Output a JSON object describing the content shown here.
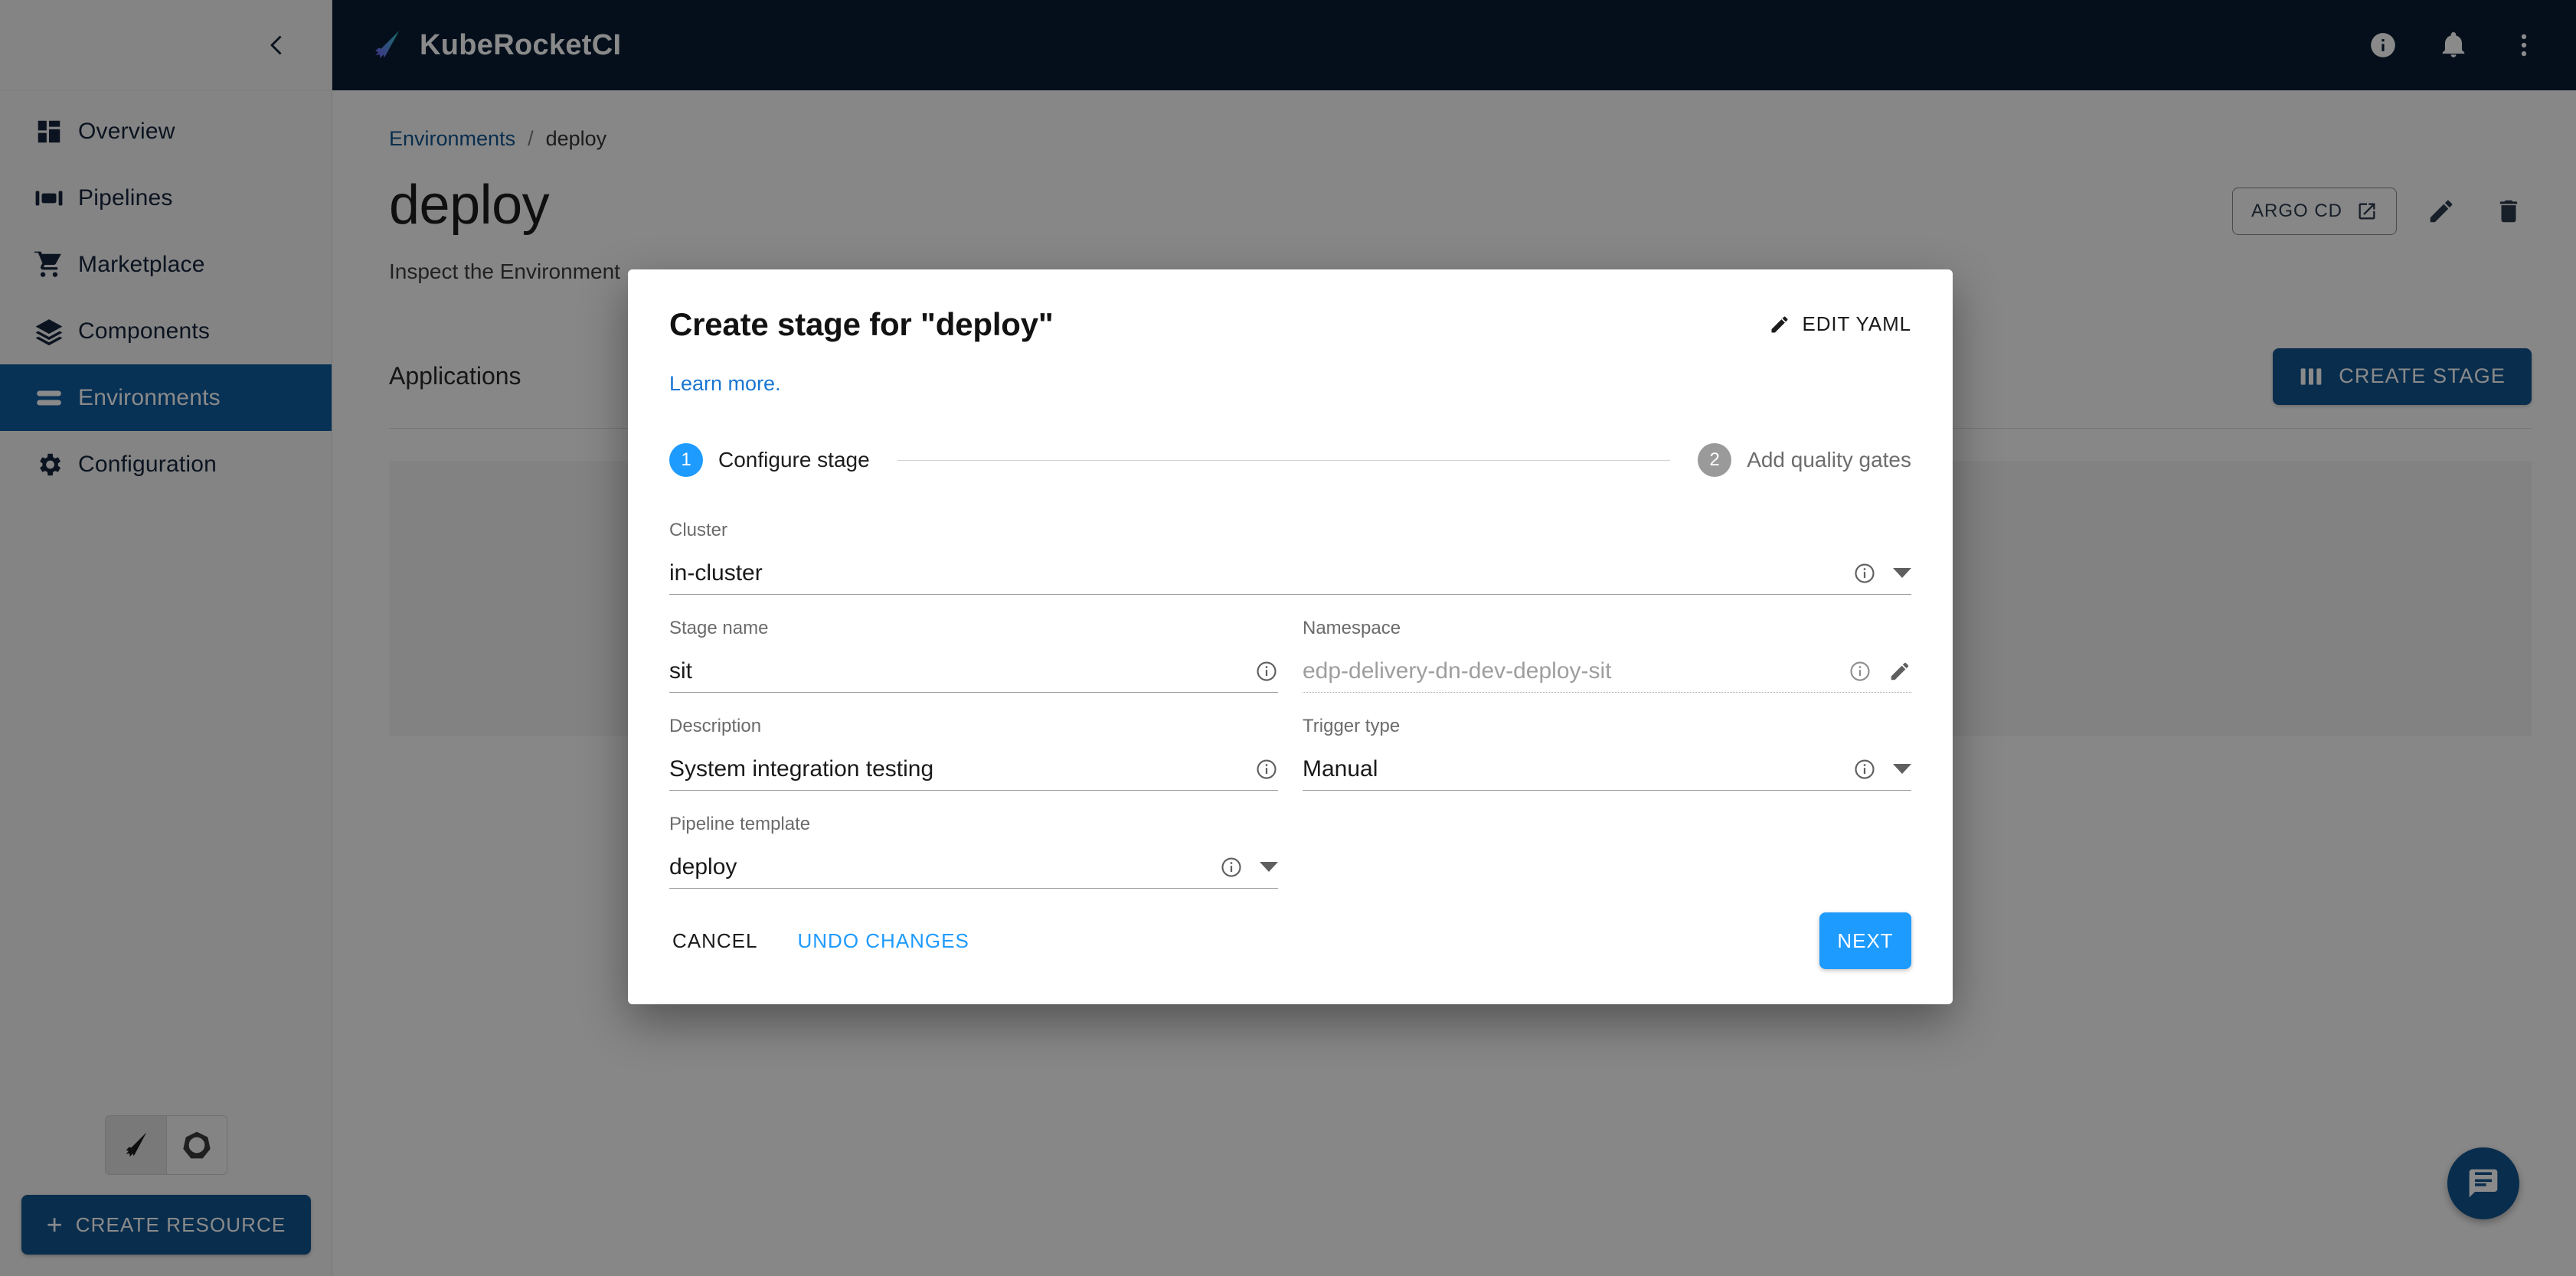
{
  "sidebar": {
    "collapse_icon": "chevron-left-icon",
    "items": [
      {
        "label": "Overview",
        "icon": "dashboard-icon",
        "active": false
      },
      {
        "label": "Pipelines",
        "icon": "pipelines-icon",
        "active": false
      },
      {
        "label": "Marketplace",
        "icon": "cart-icon",
        "active": false
      },
      {
        "label": "Components",
        "icon": "layers-icon",
        "active": false
      },
      {
        "label": "Environments",
        "icon": "environments-icon",
        "active": true
      },
      {
        "label": "Configuration",
        "icon": "gear-icon",
        "active": false
      }
    ],
    "cluster_toggle": [
      {
        "icon": "krci-feather-icon",
        "selected": true
      },
      {
        "icon": "kubernetes-icon",
        "selected": false
      }
    ],
    "create_resource_label": "CREATE RESOURCE",
    "create_resource_plus": "+"
  },
  "topbar": {
    "brand_name": "KubeRocketCI",
    "logo_icon": "krci-feather-icon",
    "actions": [
      {
        "icon": "info-circle-icon"
      },
      {
        "icon": "bell-icon"
      },
      {
        "icon": "more-vertical-icon"
      }
    ]
  },
  "main": {
    "breadcrumb": {
      "root_label": "Environments",
      "separator": "/",
      "current_label": "deploy"
    },
    "page_title": "deploy",
    "page_subtitle": "Inspect the Environment",
    "argo_cd_label": "ARGO CD",
    "argo_cd_icon": "external-link-icon",
    "edit_icon": "pencil-icon",
    "delete_icon": "trash-icon",
    "section_title": "Applications",
    "create_stage_label": "CREATE STAGE",
    "create_stage_icon": "columns-icon",
    "fab_icon": "chat-bubble-icon"
  },
  "dialog": {
    "title": "Create stage for \"deploy\"",
    "edit_yaml_label": "EDIT YAML",
    "edit_yaml_icon": "pencil-icon",
    "learn_more_label": "Learn more.",
    "steps": [
      {
        "number": "1",
        "label": "Configure stage",
        "state": "active"
      },
      {
        "number": "2",
        "label": "Add quality gates",
        "state": "inactive"
      }
    ],
    "fields": [
      {
        "name": "cluster",
        "label": "Cluster",
        "value": "in-cluster",
        "type": "select",
        "disabled": false,
        "adornments": [
          "info-circle-outline-icon",
          "chevron-down-icon"
        ]
      },
      {
        "name": "stage-name",
        "label": "Stage name",
        "value": "sit",
        "type": "text",
        "disabled": false,
        "adornments": [
          "info-circle-outline-icon"
        ]
      },
      {
        "name": "namespace",
        "label": "Namespace",
        "value": "edp-delivery-dn-dev-deploy-sit",
        "type": "text",
        "disabled": true,
        "adornments": [
          "info-circle-outline-icon",
          "pencil-icon"
        ]
      },
      {
        "name": "description",
        "label": "Description",
        "value": "System integration testing",
        "type": "text",
        "disabled": false,
        "adornments": [
          "info-circle-outline-icon"
        ]
      },
      {
        "name": "trigger-type",
        "label": "Trigger type",
        "value": "Manual",
        "type": "select",
        "disabled": false,
        "adornments": [
          "info-circle-outline-icon",
          "chevron-down-icon"
        ]
      },
      {
        "name": "pipeline-template",
        "label": "Pipeline template",
        "value": "deploy",
        "type": "select",
        "disabled": false,
        "adornments": [
          "info-circle-outline-icon",
          "chevron-down-icon"
        ]
      }
    ],
    "cancel_label": "CANCEL",
    "undo_changes_label": "UNDO CHANGES",
    "next_label": "NEXT"
  },
  "colors": {
    "brand_dark": "#081c33",
    "accent_blue": "#12548f",
    "link_blue": "#1976d2",
    "step_active": "#1e9bff",
    "sidebar_bg": "#f4f4f4"
  }
}
